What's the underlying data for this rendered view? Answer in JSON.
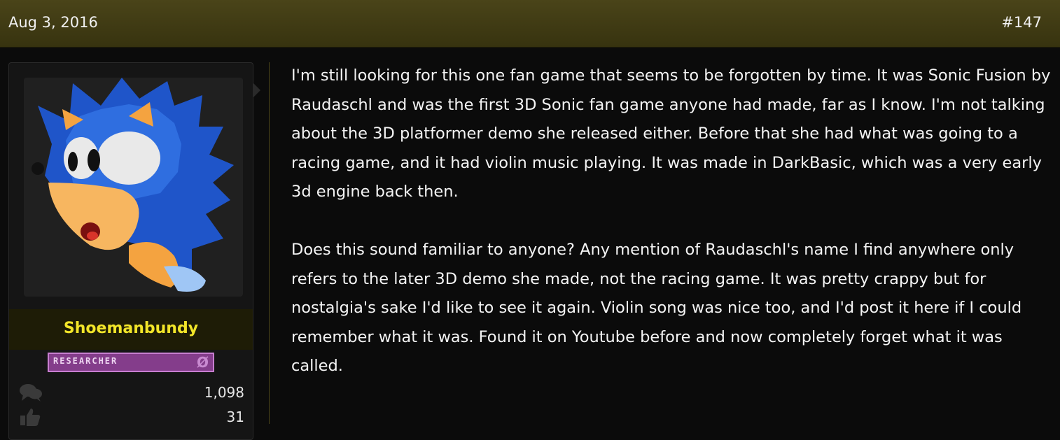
{
  "post": {
    "date": "Aug 3, 2016",
    "number": "#147",
    "paragraphs": [
      "I'm still looking for this one fan game that seems to be forgotten by time. It was Sonic Fusion by Raudaschl and was the first 3D Sonic fan game anyone had made, far as I know. I'm not talking about the 3D platformer demo she released either. Before that she had what was going to a racing game, and it had violin music playing. It was made in DarkBasic, which was a very early 3d engine back then.",
      "Does this sound familiar to anyone? Any mention of Raudaschl's name I find anywhere only refers to the later 3D demo she made, not the racing game. It was pretty crappy but for nostalgia's sake I'd like to see it again. Violin song was nice too, and I'd post it here if I could remember what it was. Found it on Youtube before and now completely forget what it was called."
    ]
  },
  "user": {
    "username": "Shoemanbundy",
    "badge_text": "RESEARCHER",
    "badge_mark": "Ø",
    "avatar_icon": "sonic-avatar",
    "stats": [
      {
        "icon": "messages-icon",
        "value": "1,098"
      },
      {
        "icon": "thumbs-up-icon",
        "value": "31"
      }
    ]
  },
  "colors": {
    "header_bg": "#4a4419",
    "username": "#f2e529",
    "badge_bg": "#843d8b",
    "page_bg": "#0b0b0b"
  }
}
